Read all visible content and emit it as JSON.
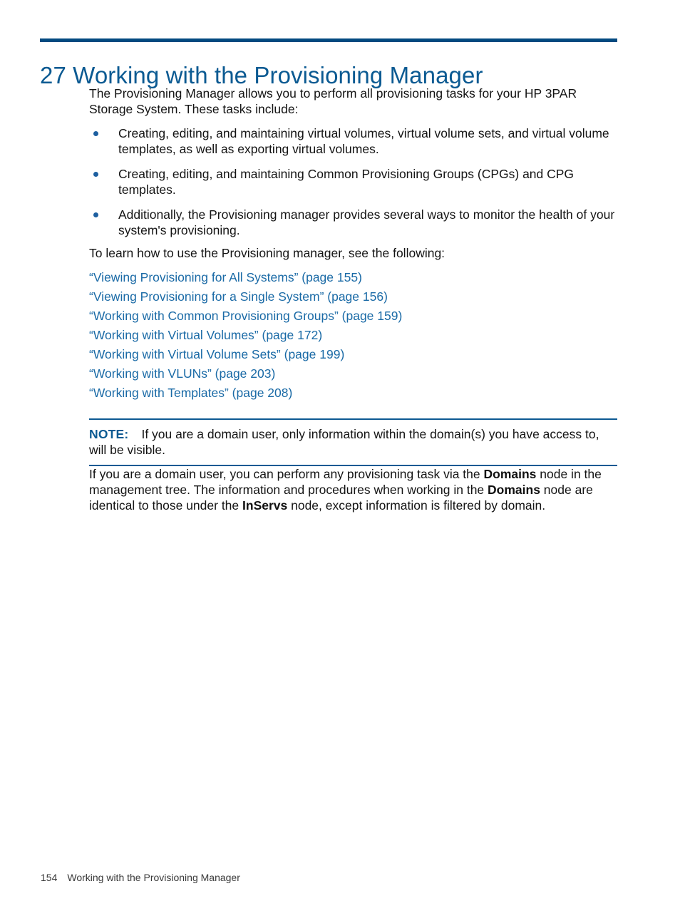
{
  "chapter": {
    "number": "27",
    "title": "27 Working with the Provisioning Manager",
    "rule_color": "#034a80",
    "title_color": "#0b5a92"
  },
  "intro": {
    "paragraph": "The Provisioning Manager allows you to perform all provisioning tasks for your HP 3PAR Storage System. These tasks include:"
  },
  "bullets": [
    "Creating, editing, and maintaining virtual volumes, virtual volume sets, and virtual volume templates, as well as exporting virtual volumes.",
    "Creating, editing, and maintaining Common Provisioning Groups (CPGs) and CPG templates.",
    "Additionally, the Provisioning manager provides several ways to monitor the health of your system's provisioning."
  ],
  "learn_more": {
    "lead_in": "To learn how to use the Provisioning manager, see the following:",
    "links": [
      "“Viewing Provisioning for All Systems” (page 155)",
      "“Viewing Provisioning for a Single System” (page 156)",
      "“Working with Common Provisioning Groups” (page 159)",
      "“Working with Virtual Volumes” (page 172)",
      "“Working with Virtual Volume Sets” (page 199)",
      "“Working with VLUNs” (page 203)",
      "“Working with Templates” (page 208)"
    ],
    "link_color": "#1a6aa6"
  },
  "note": {
    "label": "NOTE:",
    "text": "If you are a domain user, only information within the domain(s) you have access to, will be visible.",
    "accent_color": "#0d5a93"
  },
  "closing": {
    "part1": "If you are a domain user, you can perform any provisioning task via the ",
    "bold1": "Domains",
    "part2": " node in the management tree. The information and procedures when working in the ",
    "bold2": "Domains",
    "part3": " node are identical to those under the ",
    "bold3": "InServs",
    "part4": " node, except information is filtered by domain."
  },
  "footer": {
    "page_number": "154",
    "running_title": "Working with the Provisioning Manager"
  }
}
